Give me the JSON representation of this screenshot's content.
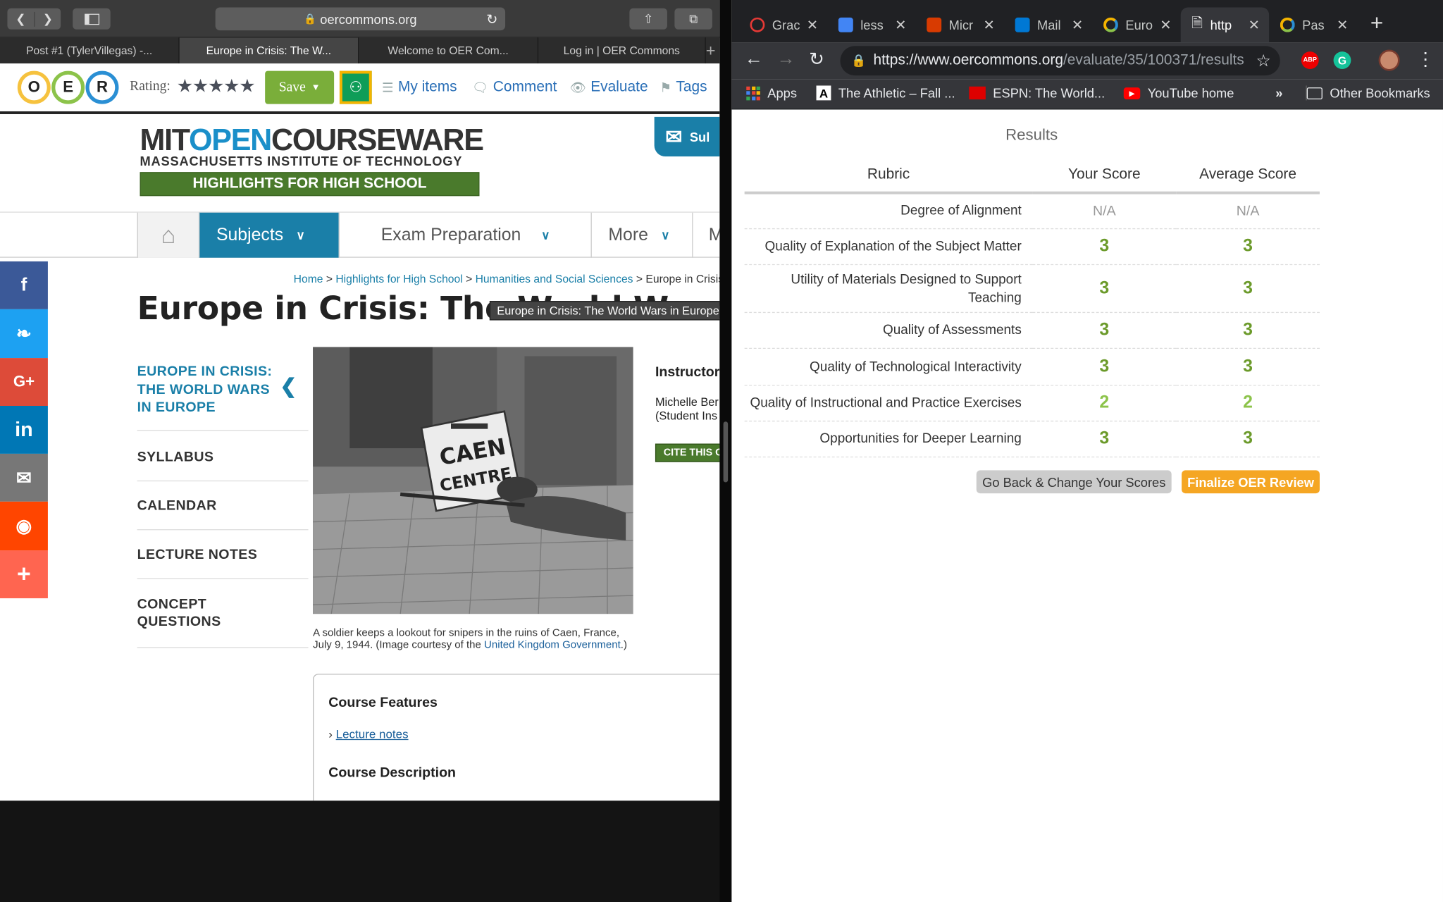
{
  "safari": {
    "address": "oercommons.org",
    "tabs": [
      "Post #1 (TylerVillegas) -...",
      "Europe in Crisis: The W...",
      "Welcome to OER Com...",
      "Log in | OER Commons"
    ],
    "active_tab": 1
  },
  "oer_bar": {
    "logo_letters": [
      "O",
      "E",
      "R"
    ],
    "rating_label": "Rating:",
    "stars": "★★★★★",
    "save_label": "Save",
    "my_items": "My items",
    "comment": "Comment",
    "evaluate": "Evaluate",
    "tags": "Tags"
  },
  "mit": {
    "title_mit": "MIT",
    "title_open": "OPEN",
    "title_cw": "COURSEWARE",
    "subtitle": "MASSACHUSETTS INSTITUTE OF TECHNOLOGY",
    "banner": "HIGHLIGHTS FOR HIGH SCHOOL",
    "subscribe": "Sul",
    "nav": {
      "subjects": "Subjects",
      "exam": "Exam Preparation",
      "more": "More",
      "m": "M"
    }
  },
  "breadcrumb": {
    "home": "Home",
    "hs": "Highlights for High School",
    "humanities": "Humanities and Social Sciences",
    "current": "Europe in Crisis",
    "sep": ">"
  },
  "page": {
    "title": "Europe in Crisis: The World Wars in Eu",
    "tooltip": "Europe in Crisis: The World Wars in Europe",
    "course_nav": [
      "EUROPE IN CRISIS: THE WORLD WARS IN EUROPE",
      "SYLLABUS",
      "CALENDAR",
      "LECTURE NOTES",
      "CONCEPT QUESTIONS"
    ],
    "caption_text": "A soldier keeps a lookout for snipers in the ruins of Caen, France, July 9, 1944. (Image courtesy of the ",
    "caption_link": "United Kingdom Government",
    "caption_end": ".)",
    "photo_sign_1": "CAEN",
    "photo_sign_2": "CENTRE",
    "instructor_label": "Instructor",
    "instructor_name": "Michelle Ber (Student Ins",
    "cite": "CITE THIS C",
    "features_title": "Course Features",
    "features_link": "Lecture notes",
    "description_title": "Course Description"
  },
  "chrome": {
    "tabs": [
      {
        "label": "Grac",
        "color": "#e53935"
      },
      {
        "label": "less",
        "color": "#4285f4"
      },
      {
        "label": "Micr",
        "color": "#d83b01"
      },
      {
        "label": "Mail",
        "color": "#0078d4"
      },
      {
        "label": "Euro",
        "color": "#f4b400"
      },
      {
        "label": "http",
        "color": "#9aa0a6"
      },
      {
        "label": "Pas",
        "color": "#f4b400"
      }
    ],
    "url_host": "https://www.oercommons.org",
    "url_path": "/evaluate/35/100371/results",
    "bookmarks": [
      "Apps",
      "The Athletic – Fall ...",
      "ESPN: The World...",
      "YouTube home"
    ],
    "other_bookmarks": "Other Bookmarks",
    "overflow": "»"
  },
  "results": {
    "title": "Results",
    "headers": {
      "rubric": "Rubric",
      "yours": "Your Score",
      "avg": "Average Score"
    },
    "rows": [
      {
        "criterion": "Degree of Alignment",
        "yours": "N/A",
        "avg": "N/A"
      },
      {
        "criterion": "Quality of Explanation of the Subject Matter",
        "yours": "3",
        "avg": "3"
      },
      {
        "criterion": "Utility of Materials Designed to Support Teaching",
        "yours": "3",
        "avg": "3"
      },
      {
        "criterion": "Quality of Assessments",
        "yours": "3",
        "avg": "3"
      },
      {
        "criterion": "Quality of Technological Interactivity",
        "yours": "3",
        "avg": "3"
      },
      {
        "criterion": "Quality of Instructional and Practice Exercises",
        "yours": "2",
        "avg": "2"
      },
      {
        "criterion": "Opportunities for Deeper Learning",
        "yours": "3",
        "avg": "3"
      }
    ],
    "back_button": "Go Back & Change Your Scores",
    "finalize_button": "Finalize OER Review"
  }
}
